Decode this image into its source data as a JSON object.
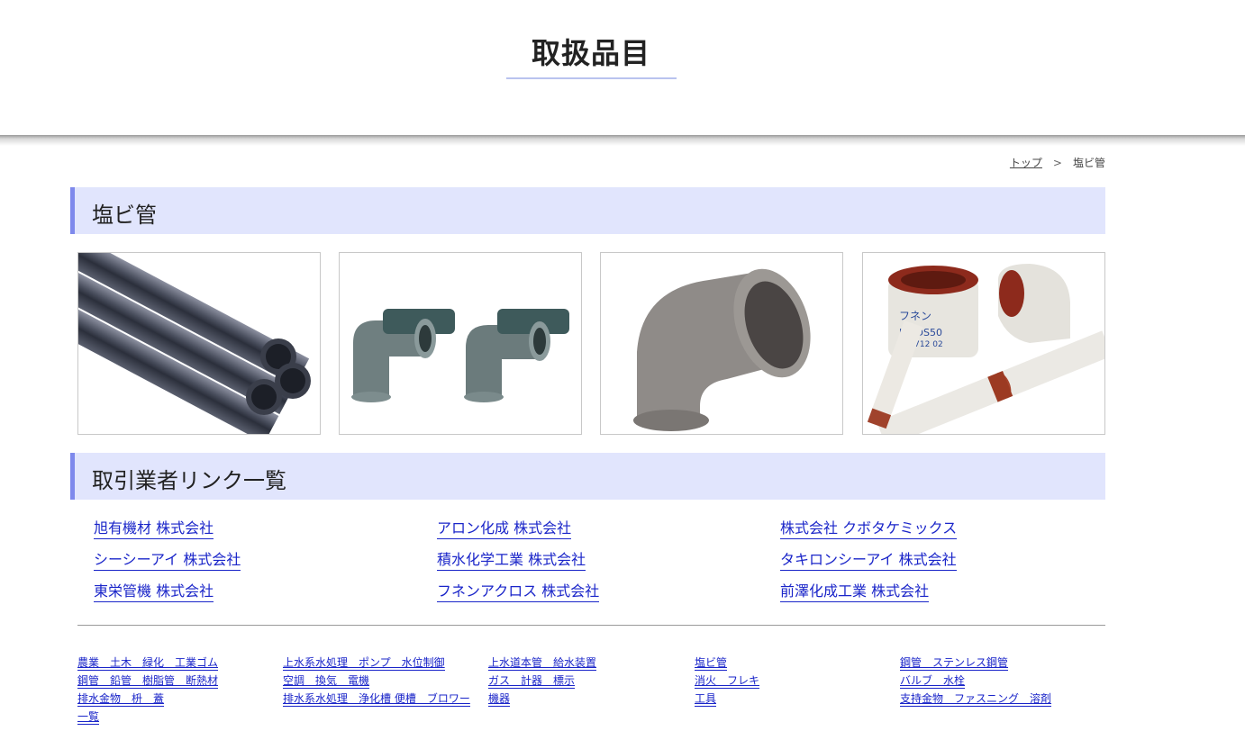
{
  "header": {
    "title": "取扱品目"
  },
  "breadcrumb": {
    "top": "トップ",
    "separator": ">",
    "current": "塩ビ管"
  },
  "sections": {
    "category": "塩ビ管",
    "vendors_heading": "取引業者リンク一覧"
  },
  "products": [
    {
      "name": "pvc-pipes-photo"
    },
    {
      "name": "pvc-elbow-fittings-photo"
    },
    {
      "name": "gray-pvc-elbow-photo"
    },
    {
      "name": "lined-pipe-fittings-photo",
      "label_1": "フネン",
      "label_2": "HT DS50",
      "label_3": "110712 02"
    }
  ],
  "vendors": [
    [
      "旭有機材 株式会社",
      "アロン化成 株式会社",
      "株式会社 クボタケミックス"
    ],
    [
      "シーシーアイ 株式会社",
      "積水化学工業 株式会社",
      "タキロンシーアイ 株式会社"
    ],
    [
      "東栄管機 株式会社",
      "フネンアクロス 株式会社",
      "前澤化成工業 株式会社"
    ]
  ],
  "footer": {
    "col1": [
      "農業　土木　緑化　工業ゴム",
      "鋼管　鉛管　樹脂管　断熱材",
      "排水金物　枡　蓋",
      "一覧"
    ],
    "col2": [
      "上水系水処理　ポンプ　水位制御",
      "空調　換気　電機",
      "排水系水処理　浄化槽 便槽　ブロワー"
    ],
    "col3": [
      "上水道本管　給水装置",
      "ガス　計器　標示",
      "機器"
    ],
    "col4": [
      "塩ビ管",
      "消火　フレキ",
      "工具"
    ],
    "col5": [
      "鋼管　ステンレス鋼管",
      "バルブ　水栓",
      "支持金物　ファスニング　溶剤"
    ]
  },
  "colors": {
    "heading_bg": "#e1e5fd",
    "heading_accent": "#7e89ec",
    "link": "#1a25c9"
  }
}
